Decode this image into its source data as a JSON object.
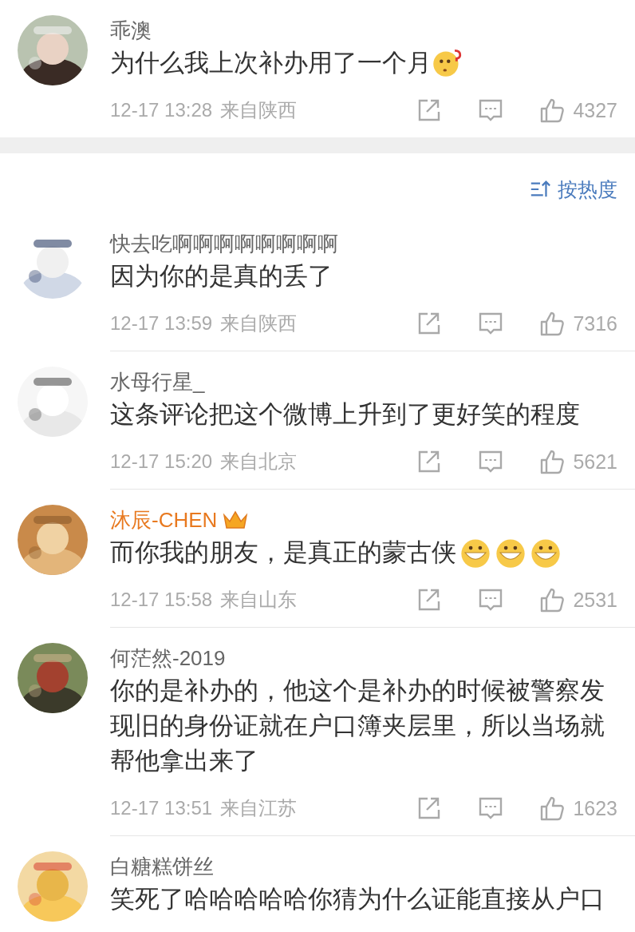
{
  "top_comment": {
    "name": "乖澳",
    "vip": false,
    "text": "为什么我上次补办用了一个月",
    "emojis": [
      {
        "kind": "puzzled"
      }
    ],
    "date": "12-17 13:28",
    "location": "来自陕西",
    "likes": "4327"
  },
  "sort": {
    "label": "按热度"
  },
  "comments": [
    {
      "name": "快去吃啊啊啊啊啊啊啊啊",
      "vip": false,
      "text": "因为你的是真的丢了",
      "date": "12-17 13:59",
      "location": "来自陕西",
      "likes": "7316"
    },
    {
      "name": "水母行星_",
      "vip": false,
      "text": "这条评论把这个微博上升到了更好笑的程度",
      "date": "12-17 15:20",
      "location": "来自北京",
      "likes": "5621"
    },
    {
      "name": "沐辰-CHEN",
      "vip": true,
      "text": "而你我的朋友，是真正的蒙古侠",
      "emojis": [
        {
          "kind": "grin"
        },
        {
          "kind": "grin"
        },
        {
          "kind": "grin"
        }
      ],
      "date": "12-17 15:58",
      "location": "来自山东",
      "likes": "2531"
    },
    {
      "name": "何茫然-2019",
      "vip": false,
      "text": "你的是补办的，他这个是补办的时候被警察发现旧的身份证就在户口簿夹层里，所以当场就帮他拿出来了",
      "date": "12-17 13:51",
      "location": "来自江苏",
      "likes": "1623"
    },
    {
      "name": "白糖糕饼丝",
      "vip": false,
      "text": "笑死了哈哈哈哈哈你猜为什么证能直接从户口"
    }
  ]
}
